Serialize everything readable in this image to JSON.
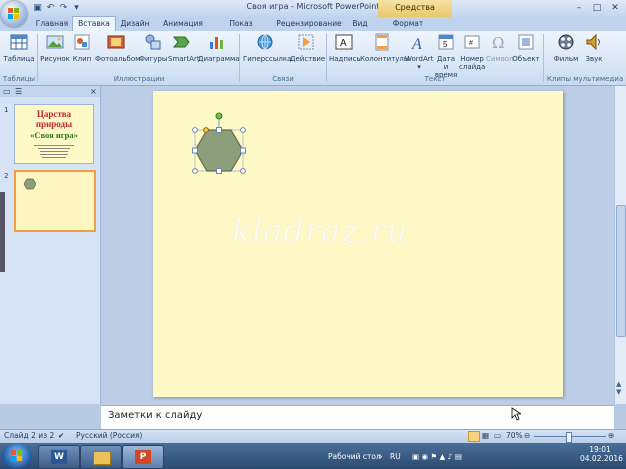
{
  "window": {
    "title": "Своя игра - Microsoft PowerPoint",
    "context_tab": "Средства рисования",
    "buttons": [
      "–",
      "□",
      "✕"
    ]
  },
  "qat": {
    "icons": [
      "save-icon",
      "undo-icon",
      "redo-icon",
      "dropdown-icon"
    ]
  },
  "tabs": [
    {
      "label": "Главная",
      "active": false
    },
    {
      "label": "Вставка",
      "active": true
    },
    {
      "label": "Дизайн",
      "active": false
    },
    {
      "label": "Анимация",
      "active": false
    },
    {
      "label": "Показ слайдов",
      "active": false
    },
    {
      "label": "Рецензирование",
      "active": false
    },
    {
      "label": "Вид",
      "active": false
    },
    {
      "label": "Формат",
      "active": false
    }
  ],
  "ribbon": {
    "buttons": [
      {
        "label": "Таблица",
        "icon": "table-icon"
      },
      {
        "label": "Рисунок",
        "icon": "picture-icon"
      },
      {
        "label": "Клип",
        "icon": "clip-icon"
      },
      {
        "label": "Фотоальбом",
        "icon": "photo-album-icon"
      },
      {
        "label": "Фигуры",
        "icon": "shapes-icon"
      },
      {
        "label": "SmartArt",
        "icon": "smartart-icon"
      },
      {
        "label": "Диаграмма",
        "icon": "chart-icon"
      },
      {
        "label": "Гиперссылка",
        "icon": "hyperlink-icon"
      },
      {
        "label": "Действие",
        "icon": "action-icon"
      },
      {
        "label": "Надпись",
        "icon": "textbox-icon"
      },
      {
        "label": "Колонтитулы",
        "icon": "header-footer-icon"
      },
      {
        "label": "WordArt",
        "icon": "wordart-icon"
      },
      {
        "label": "Дата и время",
        "icon": "date-time-icon"
      },
      {
        "label": "Номер слайда",
        "icon": "slide-number-icon"
      },
      {
        "label": "Символ",
        "icon": "symbol-icon"
      },
      {
        "label": "Объект",
        "icon": "object-icon"
      },
      {
        "label": "Фильм",
        "icon": "movie-icon"
      },
      {
        "label": "Звук",
        "icon": "sound-icon"
      }
    ],
    "groups": [
      "Таблицы",
      "Иллюстрации",
      "Связи",
      "Текст",
      "Клипы мультимедиа"
    ]
  },
  "slides": {
    "thumb1": {
      "number": "1",
      "title": "Царства природы",
      "subtitle": "«Своя игра»"
    },
    "thumb2": {
      "number": "2"
    }
  },
  "slide": {
    "watermark": "kladraz.ru",
    "shape": "hexagon",
    "colors": {
      "background": "#fff9c8",
      "shape_fill": "#8c9e7a",
      "shape_stroke": "#5f6f52"
    }
  },
  "notes": {
    "placeholder": "Заметки к слайду"
  },
  "status": {
    "slide_info": "Слайд 2 из 2",
    "language": "Русский (Россия)",
    "zoom": "70%"
  },
  "taskbar": {
    "desktop_label": "Рабочий стол",
    "lang": "RU",
    "time": "19:01",
    "date": "04.02.2016"
  }
}
